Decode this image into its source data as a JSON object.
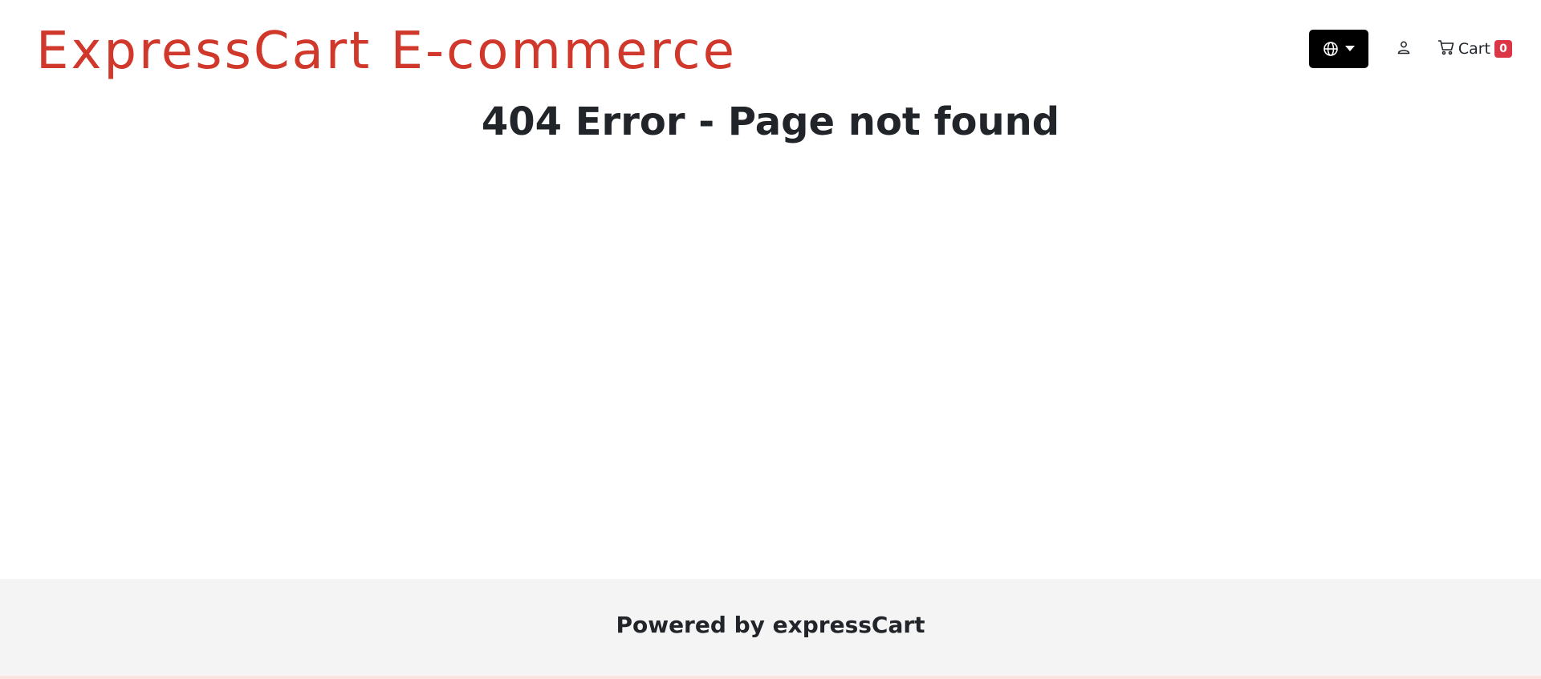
{
  "header": {
    "brand": "ExpressCart E-commerce",
    "language_button": {
      "icon": "globe-icon",
      "caret": "caret-down-icon"
    },
    "account_button": {
      "icon": "user-icon"
    },
    "cart": {
      "icon": "cart-icon",
      "label": "Cart",
      "count": "0"
    }
  },
  "main": {
    "title": "404 Error - Page not found"
  },
  "footer": {
    "text": "Powered by expressCart"
  },
  "colors": {
    "brand": "#d0382b",
    "badge": "#dc3545",
    "footer_bg": "#f4f4f4"
  }
}
